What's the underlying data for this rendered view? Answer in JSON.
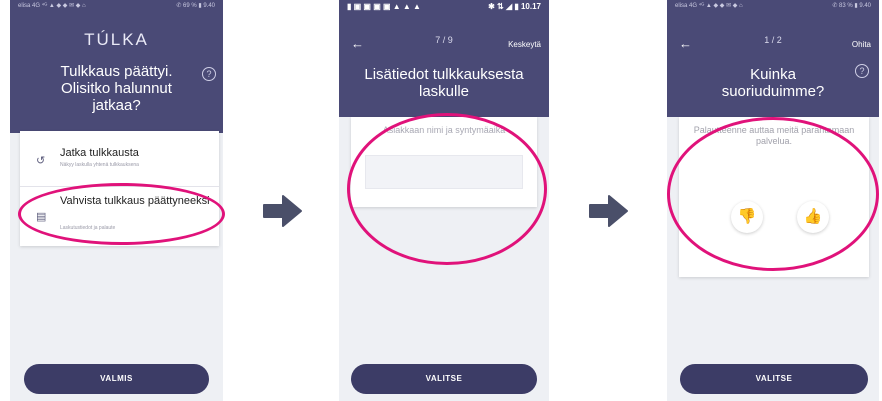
{
  "screen1": {
    "status_left": "elisa 4G ⁴ᴳ ▲ ◆ ◆ ✉ ◆ ⌂",
    "status_right": "✆ 69 % ▮ 9.40",
    "logo": "TÚLKA",
    "help_icon": "?",
    "heading": "Tulkkaus päättyi.\nOlisitko halunnut\njatkaa?",
    "options": [
      {
        "icon": "↺",
        "title": "Jatka tulkkausta",
        "subtitle": "Näkyy laskulla yhtenä tulkkauksena"
      },
      {
        "icon": "▤",
        "title": "Vahvista tulkkaus päättyneeksi",
        "subtitle": "Laskutustiedot ja palaute"
      }
    ],
    "button": "VALMIS"
  },
  "screen2": {
    "status_left": "▮ ▣ ▣ ▣ ▣ ▲ ▲ ▲",
    "status_right": "✱ ⇅ ◢ ▮ 10.17",
    "back_icon": "←",
    "step": "7 / 9",
    "top_action": "Keskeytä",
    "heading": "Lisätiedot tulkkauksesta\nlaskulle",
    "placeholder": "Asiakkaan nimi ja syntymäaika",
    "input_value": "",
    "button": "VALITSE"
  },
  "screen3": {
    "status_left": "elisa 4G ⁴ᴳ ▲ ◆ ◆ ✉ ◆ ⌂",
    "status_right": "✆ 83 % ▮ 9.40",
    "back_icon": "←",
    "step": "1 / 2",
    "top_action": "Ohita",
    "help_icon": "?",
    "heading": "Kuinka\nsuoriuduimme?",
    "feedback_text": "Palautteenne auttaa meitä parantamaan palvelua.",
    "thumb_down_icon": "👎",
    "thumb_up_icon": "👍",
    "button": "VALITSE"
  },
  "colors": {
    "header": "#4a4a76",
    "button": "#3c3c66",
    "highlight": "#e0127a",
    "arrow": "#4a4f69"
  }
}
